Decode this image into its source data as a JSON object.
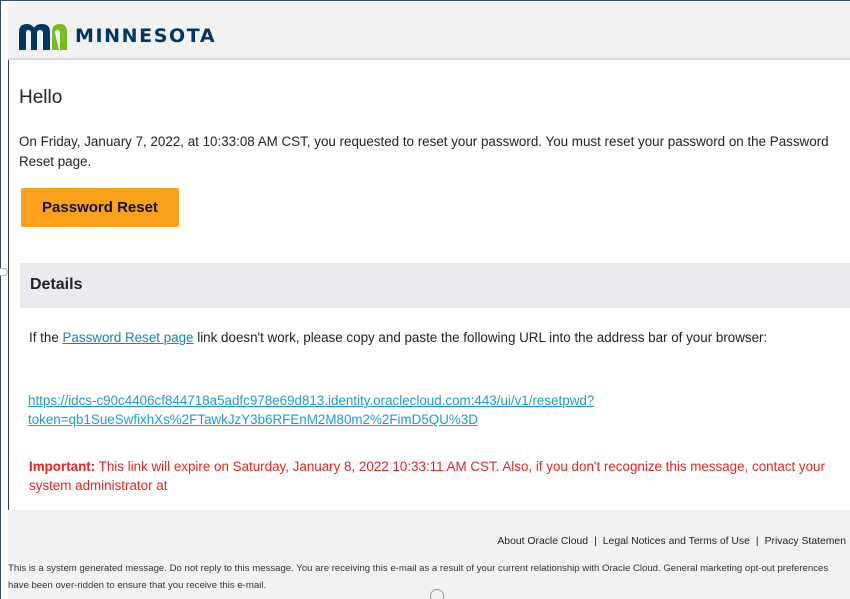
{
  "header": {
    "logo_text": "MINNESOTA",
    "logo_icon": "mn-logo-icon",
    "brand_color": "#003865"
  },
  "greeting": "Hello",
  "intro_text": "On Friday, January 7, 2022, at 10:33:08 AM CST, you requested to reset your password. You must reset your password on the Password Reset page.",
  "reset_button": {
    "label": "Password Reset",
    "color": "#f9a11b"
  },
  "details": {
    "title": "Details",
    "para_before": "If the ",
    "link_text": "Password Reset page",
    "para_after": " link doesn't work, please copy and paste the following URL into the address bar of your browser:",
    "url_line1": "https://idcs-c90c4406cf844718a5adfc978e69d813.identity.oraclecloud.com:443/ui/v1/resetpwd?",
    "url_line2": "token=qb1SueSwfixhXs%2FTawkJzY3b6RFEnM2M80m2%2FimD5QU%3D",
    "link_color": "#1e9cd7"
  },
  "important": {
    "label": "Important:",
    "text": " This link will expire on Saturday, January 8, 2022 10:33:11 AM CST. Also, if you don't recognize this message, contact your system administrator at",
    "color": "#e8251f"
  },
  "footer": {
    "links": [
      "About Oracle Cloud",
      "Legal Notices and Terms of Use",
      "Privacy Statemen"
    ],
    "separator": "|",
    "note": "This is a system generated message. Do not reply to this message. You are receiving this e-mail as a result of your current relationship with Oracle Cloud. General marketing opt-out preferences have been over-ridden to ensure that you receive this e-mail."
  }
}
